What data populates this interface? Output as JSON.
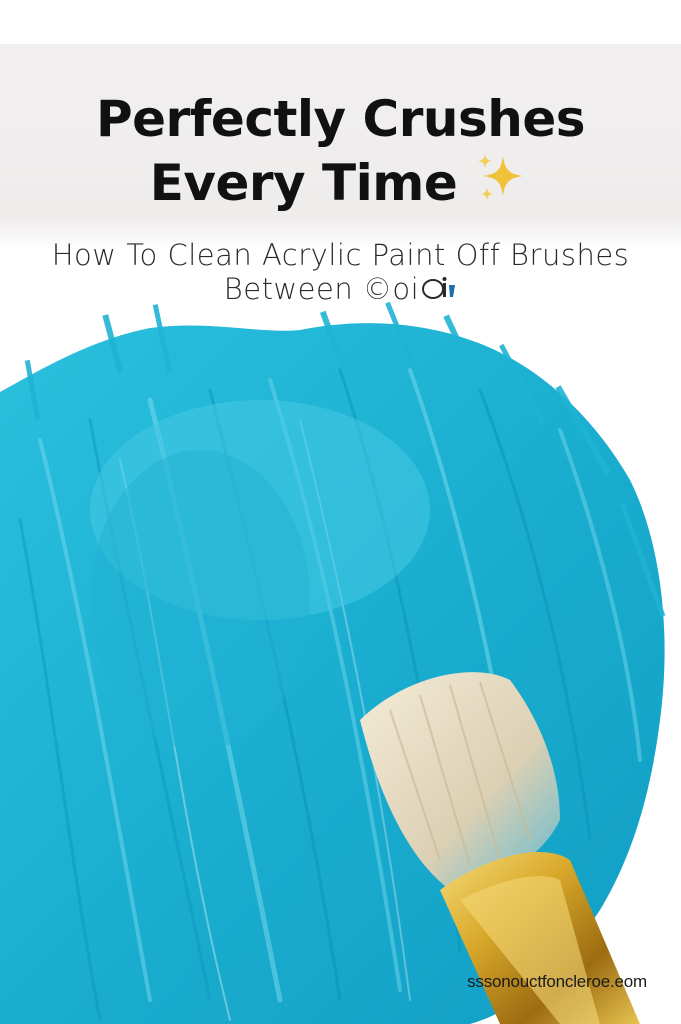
{
  "poster": {
    "title_line1": "Perfectly Crushes",
    "title_line2": "Every Time",
    "title_icon": "sparkles-icon",
    "subtitle_line1": "How To Clean Acrylic Paint Off Brushes",
    "subtitle_line2": "Between ©oi",
    "subtitle_icon": "brush-emoji-icon",
    "footer_url": "sssonouctfoncleroe.eom"
  },
  "colors": {
    "paint": "#1fb4d4",
    "paint_light": "#5fd3ea",
    "paint_dark": "#0b8fb3",
    "brush_ferrule": "#d4a32a",
    "bristles": "#e7dcc3",
    "sparkle": "#f0c23a",
    "header_band": "#efecec"
  }
}
